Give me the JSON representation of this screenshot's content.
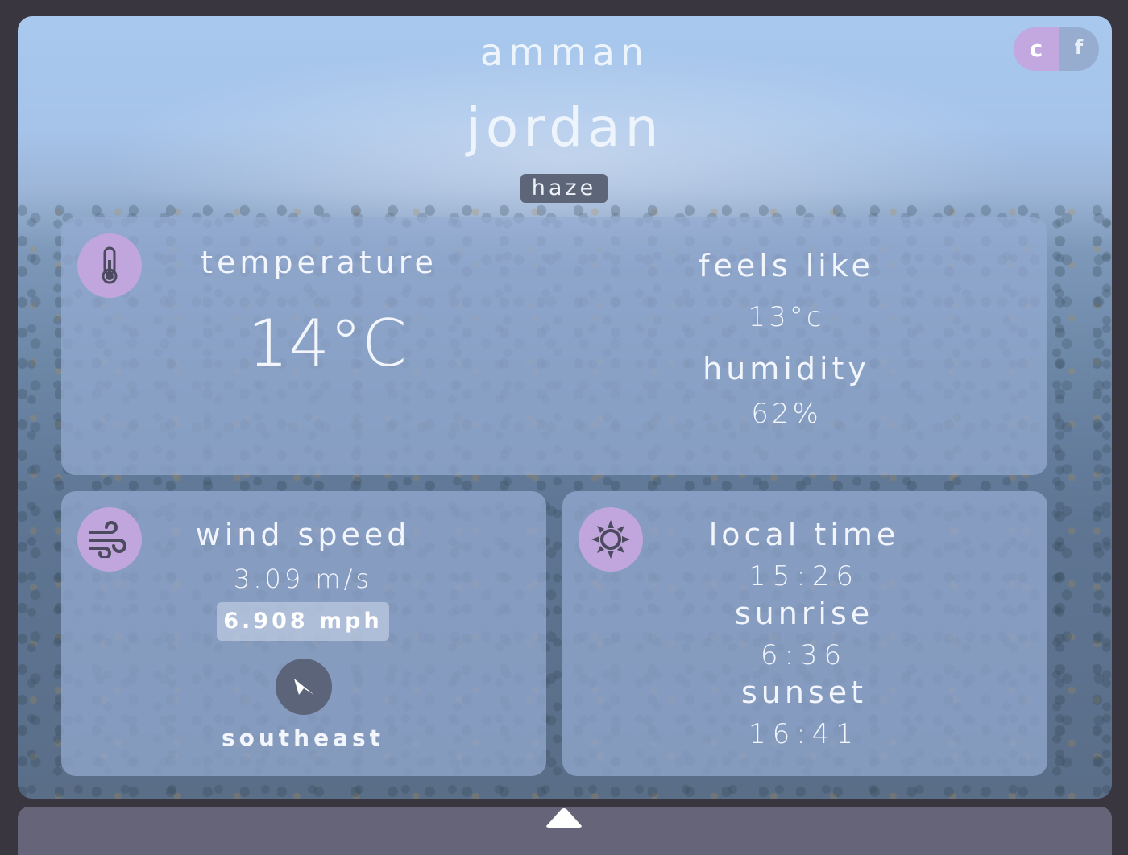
{
  "location": {
    "city": "amman",
    "country": "jordan",
    "condition": "haze"
  },
  "units": {
    "celsius_label": "c",
    "fahrenheit_label": "f",
    "selected": "c"
  },
  "temperature_card": {
    "label": "temperature",
    "value": "14°C",
    "icon": "thermometer-icon",
    "feels_like_label": "feels like",
    "feels_like_value": "13°c",
    "humidity_label": "humidity",
    "humidity_value": "62%"
  },
  "wind_card": {
    "label": "wind speed",
    "speed_ms": "3.09 m/s",
    "speed_mph": "6.908 mph",
    "direction": "southeast",
    "icon": "wind-icon",
    "compass_icon": "navigation-arrow-icon"
  },
  "time_card": {
    "icon": "sun-icon",
    "local_time_label": "local time",
    "local_time_value": "15:26",
    "sunrise_label": "sunrise",
    "sunrise_value": "6:36",
    "sunset_label": "sunset",
    "sunset_value": "16:41"
  },
  "drawer": {
    "icon": "chevron-up-icon"
  },
  "colors": {
    "accent": "#c0a6dc",
    "card": "#96acd2",
    "frame_bg": "#3a363f",
    "drawer": "#666478"
  }
}
